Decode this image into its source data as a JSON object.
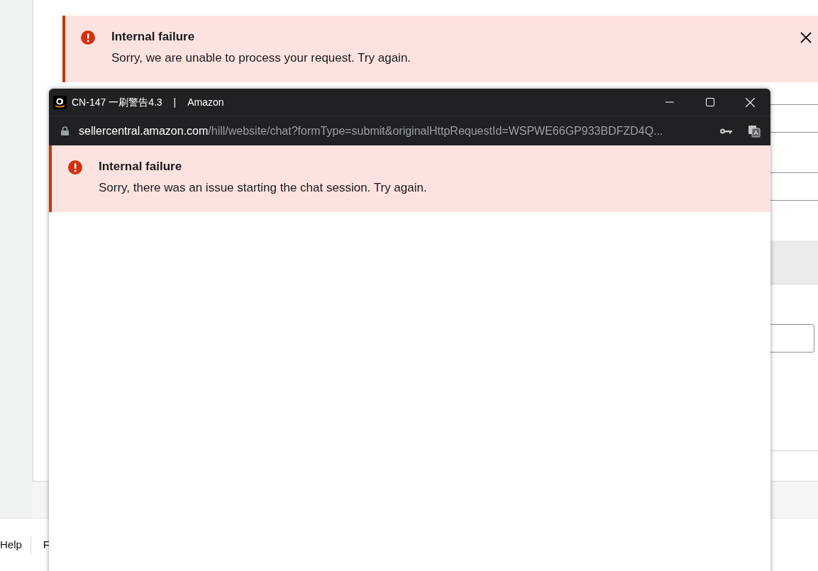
{
  "page_alert": {
    "title": "Internal failure",
    "message": "Sorry, we are unable to process your request. Try again."
  },
  "footer": {
    "links": [
      "Help",
      "F"
    ]
  },
  "popup": {
    "title": "CN-147 一刷警告4.3",
    "separator": "|",
    "site": "Amazon",
    "url_host": "sellercentral.amazon.com",
    "url_path": "/hill/website/chat?formType=submit&originalHttpRequestId=WSPWE66GP933BDFZD4Q...",
    "alert": {
      "title": "Internal failure",
      "message": "Sorry, there was an issue starting the chat session. Try again."
    }
  }
}
